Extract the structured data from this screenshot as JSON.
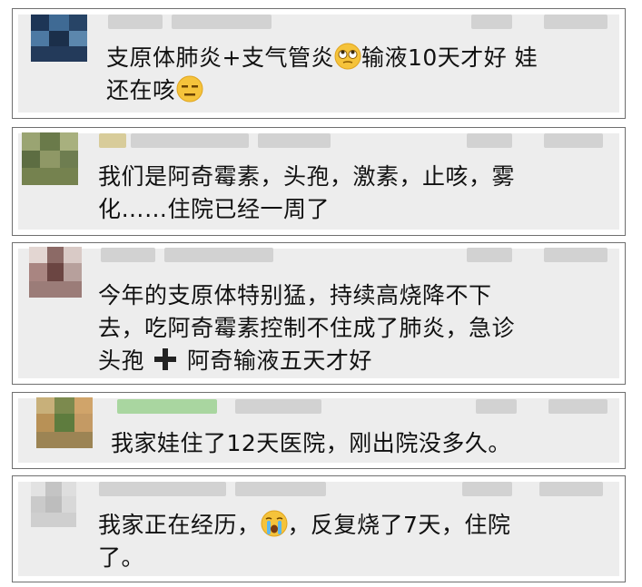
{
  "comments": [
    {
      "text_a": "支原体肺炎+支气管炎",
      "emoji_a": "rolling-eyes-emoji",
      "text_b": "输液10天才好 娃\n还在咳",
      "emoji_b": "expressionless-emoji"
    },
    {
      "text": "我们是阿奇霉素，头孢，激素，止咳，雾\n化……住院已经一周了"
    },
    {
      "text_a": "今年的支原体特别猛，持续高烧降不下\n去，吃阿奇霉素控制不住成了肺炎，急诊\n头孢 ",
      "emoji_a": "heavy-plus-emoji",
      "text_b": " 阿奇输液五天才好"
    },
    {
      "text": "我家娃住了12天医院，刚出院没多久。"
    },
    {
      "text_a": "我家正在经历，",
      "emoji_a": "crying-emoji",
      "text_b": "，反复烧了7天，住院\n了。"
    }
  ]
}
